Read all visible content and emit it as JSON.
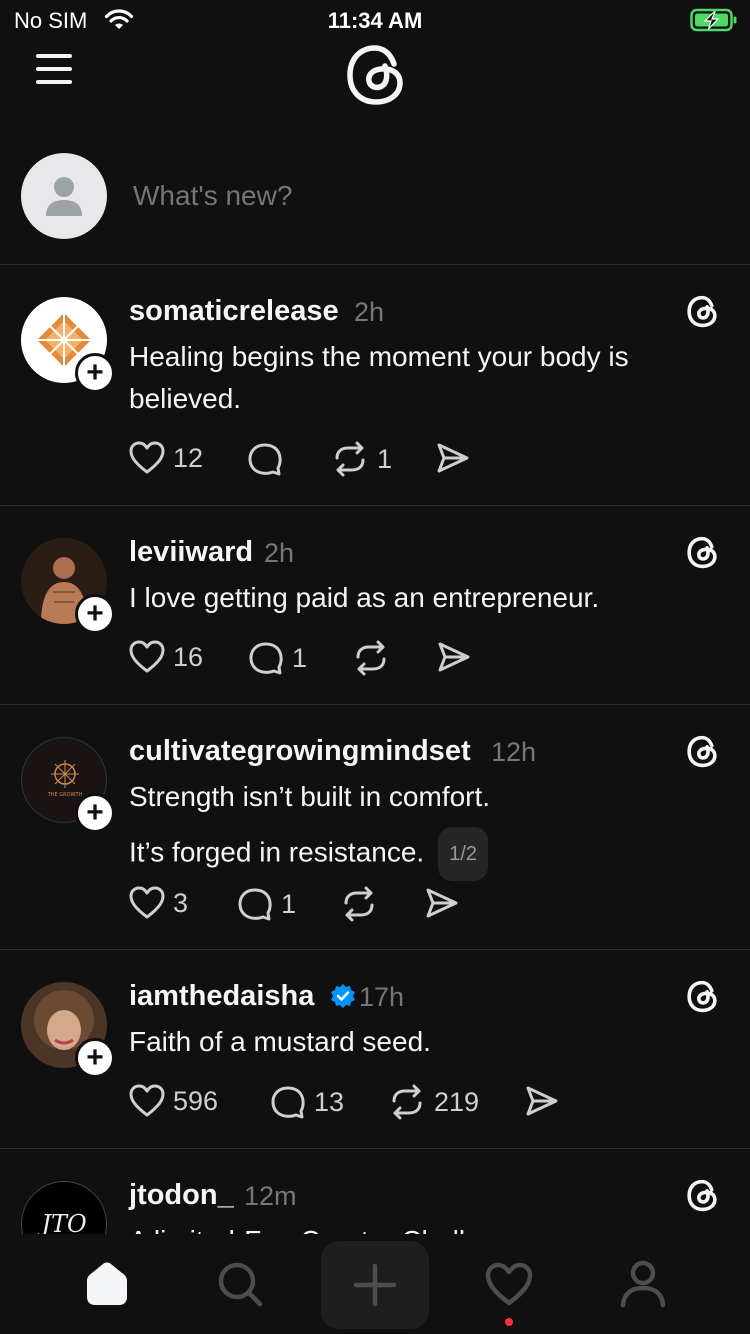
{
  "status_bar": {
    "carrier": "No SIM",
    "time": "11:34 AM",
    "battery_color": "#4cd964"
  },
  "composer": {
    "placeholder": "What's new?"
  },
  "posts": [
    {
      "username": "somaticrelease",
      "time": "2h",
      "lines": [
        "Healing begins the moment your body is",
        "believed."
      ],
      "likes": "12",
      "replies": "",
      "reposts": "1"
    },
    {
      "username": "leviiward",
      "time": "2h",
      "lines": [
        "I love getting paid as an entrepreneur."
      ],
      "likes": "16",
      "replies": "1",
      "reposts": ""
    },
    {
      "username": "cultivategrowingmindset",
      "time": "12h",
      "lines": [
        "Strength isn’t built in comfort.",
        "It’s forged in resistance."
      ],
      "page_indicator": "1/2",
      "likes": "3",
      "replies": "1",
      "reposts": "",
      "avatar_caption": "THE GROWTH"
    },
    {
      "username": "iamthedaisha",
      "time": "17h",
      "verified": true,
      "lines": [
        "Faith of a mustard seed."
      ],
      "likes": "596",
      "replies": "13",
      "reposts": "219"
    },
    {
      "username": "jtodon_",
      "time": "12m",
      "lines": [
        "A limited-Fan Creator Challenge"
      ],
      "avatar_text": "JTO"
    }
  ],
  "icons": {
    "nav": [
      "home-icon",
      "search-icon",
      "create-icon",
      "activity-icon",
      "profile-icon"
    ],
    "accent_notification": "#ff3040",
    "verified_color": "#0095f6"
  }
}
